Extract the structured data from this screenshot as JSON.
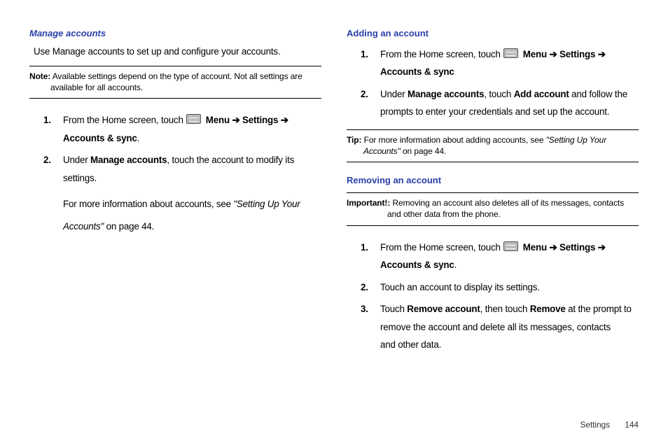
{
  "left": {
    "heading": "Manage accounts",
    "intro": "Use Manage accounts to set up and configure your accounts.",
    "note": {
      "label": "Note:",
      "line1": "Available settings depend on the type of account.  Not all settings are",
      "line2": "available for all accounts."
    },
    "steps": {
      "s1": {
        "a": "From the Home screen, touch ",
        "menu": "Menu",
        "arrow1": " ➔ ",
        "settings": "Settings",
        "arrow2": " ➔",
        "line2": "Accounts & sync",
        "period": "."
      },
      "s2": {
        "a": "Under ",
        "ma": "Manage accounts",
        "b": ", touch the account to modify its",
        "line2": "settings."
      },
      "more": {
        "a": "For more information about accounts, see ",
        "it": "\"Setting Up Your",
        "line2it": "Accounts\"",
        "rest": " on page 44."
      }
    }
  },
  "right": {
    "add": {
      "heading": "Adding an account",
      "s1": {
        "a": "From the Home screen, touch ",
        "menu": "Menu",
        "arrow1": " ➔ ",
        "settings": "Settings",
        "arrow2": " ➔",
        "line2": "Accounts & sync"
      },
      "s2": {
        "a": "Under ",
        "ma": "Manage accounts",
        "b": ", touch ",
        "aa": "Add account",
        "c": " and follow the",
        "line2": "prompts to enter your credentials and set up the account."
      }
    },
    "tip": {
      "label": "Tip:",
      "line1": "For more information about adding accounts, see ",
      "it1": "\"Setting Up Your",
      "it2": "Accounts\"",
      "rest": " on page 44."
    },
    "remove": {
      "heading": "Removing an account",
      "imp": {
        "label": "Important!:",
        "line1": "Removing an account also deletes all of its messages, contacts",
        "line2": "and other data from the phone."
      },
      "s1": {
        "a": "From the Home screen, touch ",
        "menu": "Menu",
        "arrow1": " ➔ ",
        "settings": "Settings",
        "arrow2": " ➔",
        "line2": "Accounts & sync",
        "period": "."
      },
      "s2": "Touch an account to display its settings.",
      "s3": {
        "a": "Touch ",
        "ra": "Remove account",
        "b": ", then touch ",
        "rm": "Remove",
        "c": " at the prompt to",
        "line2": "remove the account and delete all its messages, contacts",
        "line3": "and other data."
      }
    }
  },
  "footer": {
    "section": "Settings",
    "page": "144"
  }
}
